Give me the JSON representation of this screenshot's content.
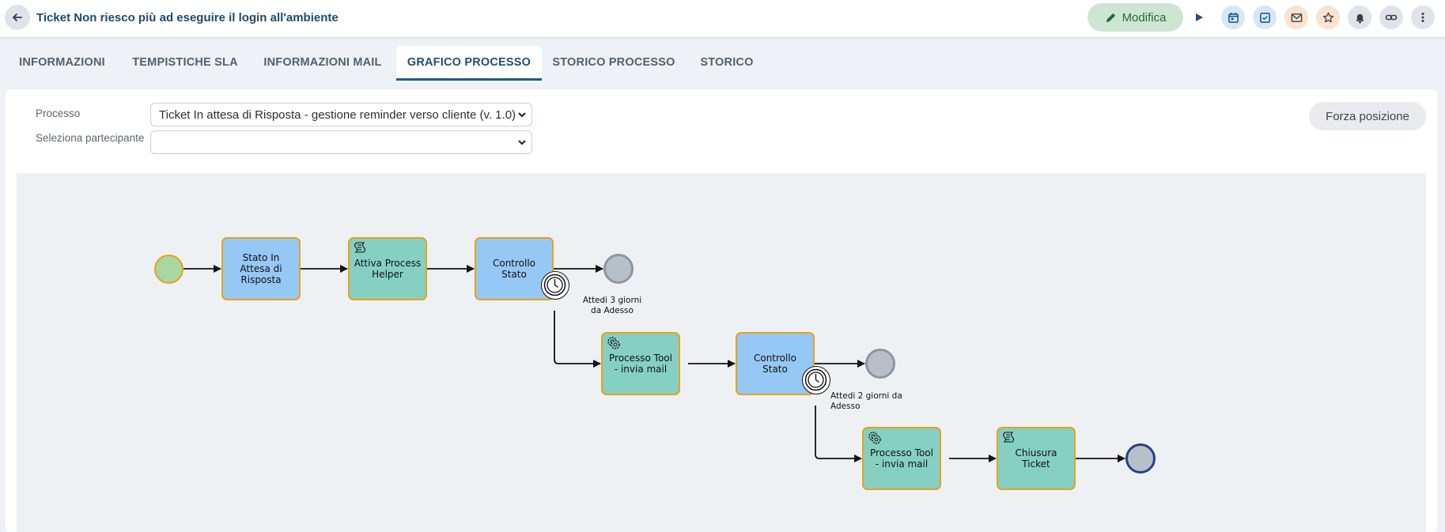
{
  "header": {
    "title": "Ticket Non riesco più ad eseguire il login all'ambiente",
    "modifica_label": "Modifica",
    "buttons": [
      {
        "icon": "play-icon",
        "color": "transparent"
      },
      {
        "icon": "calendar-icon",
        "color": "#d6e8f7"
      },
      {
        "icon": "checklist-icon",
        "color": "#d6e8f7"
      },
      {
        "icon": "mail-icon",
        "color": "#fbe3cf"
      },
      {
        "icon": "star-icon",
        "color": "#fbe3cf"
      },
      {
        "icon": "bell-icon",
        "color": "#dfe4ea"
      },
      {
        "icon": "link-icon",
        "color": "#dfe4ea"
      },
      {
        "icon": "more-vertical-icon",
        "color": "#dfe4ea"
      }
    ]
  },
  "tabs": [
    {
      "label": "INFORMAZIONI",
      "active": false
    },
    {
      "label": "TEMPISTICHE SLA",
      "active": false
    },
    {
      "label": "INFORMAZIONI MAIL",
      "active": false
    },
    {
      "label": "GRAFICO PROCESSO",
      "active": true
    },
    {
      "label": "STORICO PROCESSO",
      "active": false
    },
    {
      "label": "STORICO",
      "active": false
    }
  ],
  "form": {
    "processo_label": "Processo",
    "processo_value": "Ticket In attesa di Risposta - gestione reminder verso cliente (v. 1.0)",
    "partecipante_label": "Seleziona partecipante",
    "partecipante_value": "",
    "forza_label": "Forza posizione"
  },
  "diagram": {
    "tasks": [
      {
        "label": "Stato In Attesa di Risposta",
        "color": "blue",
        "icon": ""
      },
      {
        "label": "Attiva Process Helper",
        "color": "green",
        "icon": "script-icon"
      },
      {
        "label": "Controllo Stato",
        "color": "blue",
        "icon": ""
      },
      {
        "label": "Processo Tool - invia mail",
        "color": "green",
        "icon": "service-gear-icon"
      },
      {
        "label": "Controllo Stato",
        "color": "blue",
        "icon": ""
      },
      {
        "label": "Processo Tool - invia mail",
        "color": "green",
        "icon": "service-gear-icon"
      },
      {
        "label": "Chiusura Ticket",
        "color": "green",
        "icon": "script-icon"
      }
    ],
    "timer_labels": [
      "Attedi 3 giorni da Adesso",
      "Attedi 2 giorni da Adesso"
    ],
    "colors": {
      "task_border": "#e8a21a",
      "task_blue": "#96c8f5",
      "task_green": "#85d0c3",
      "start_event": "#a9d7a2",
      "end_event": "#b7bfc8",
      "final_end_border": "#2a3c8f"
    }
  }
}
